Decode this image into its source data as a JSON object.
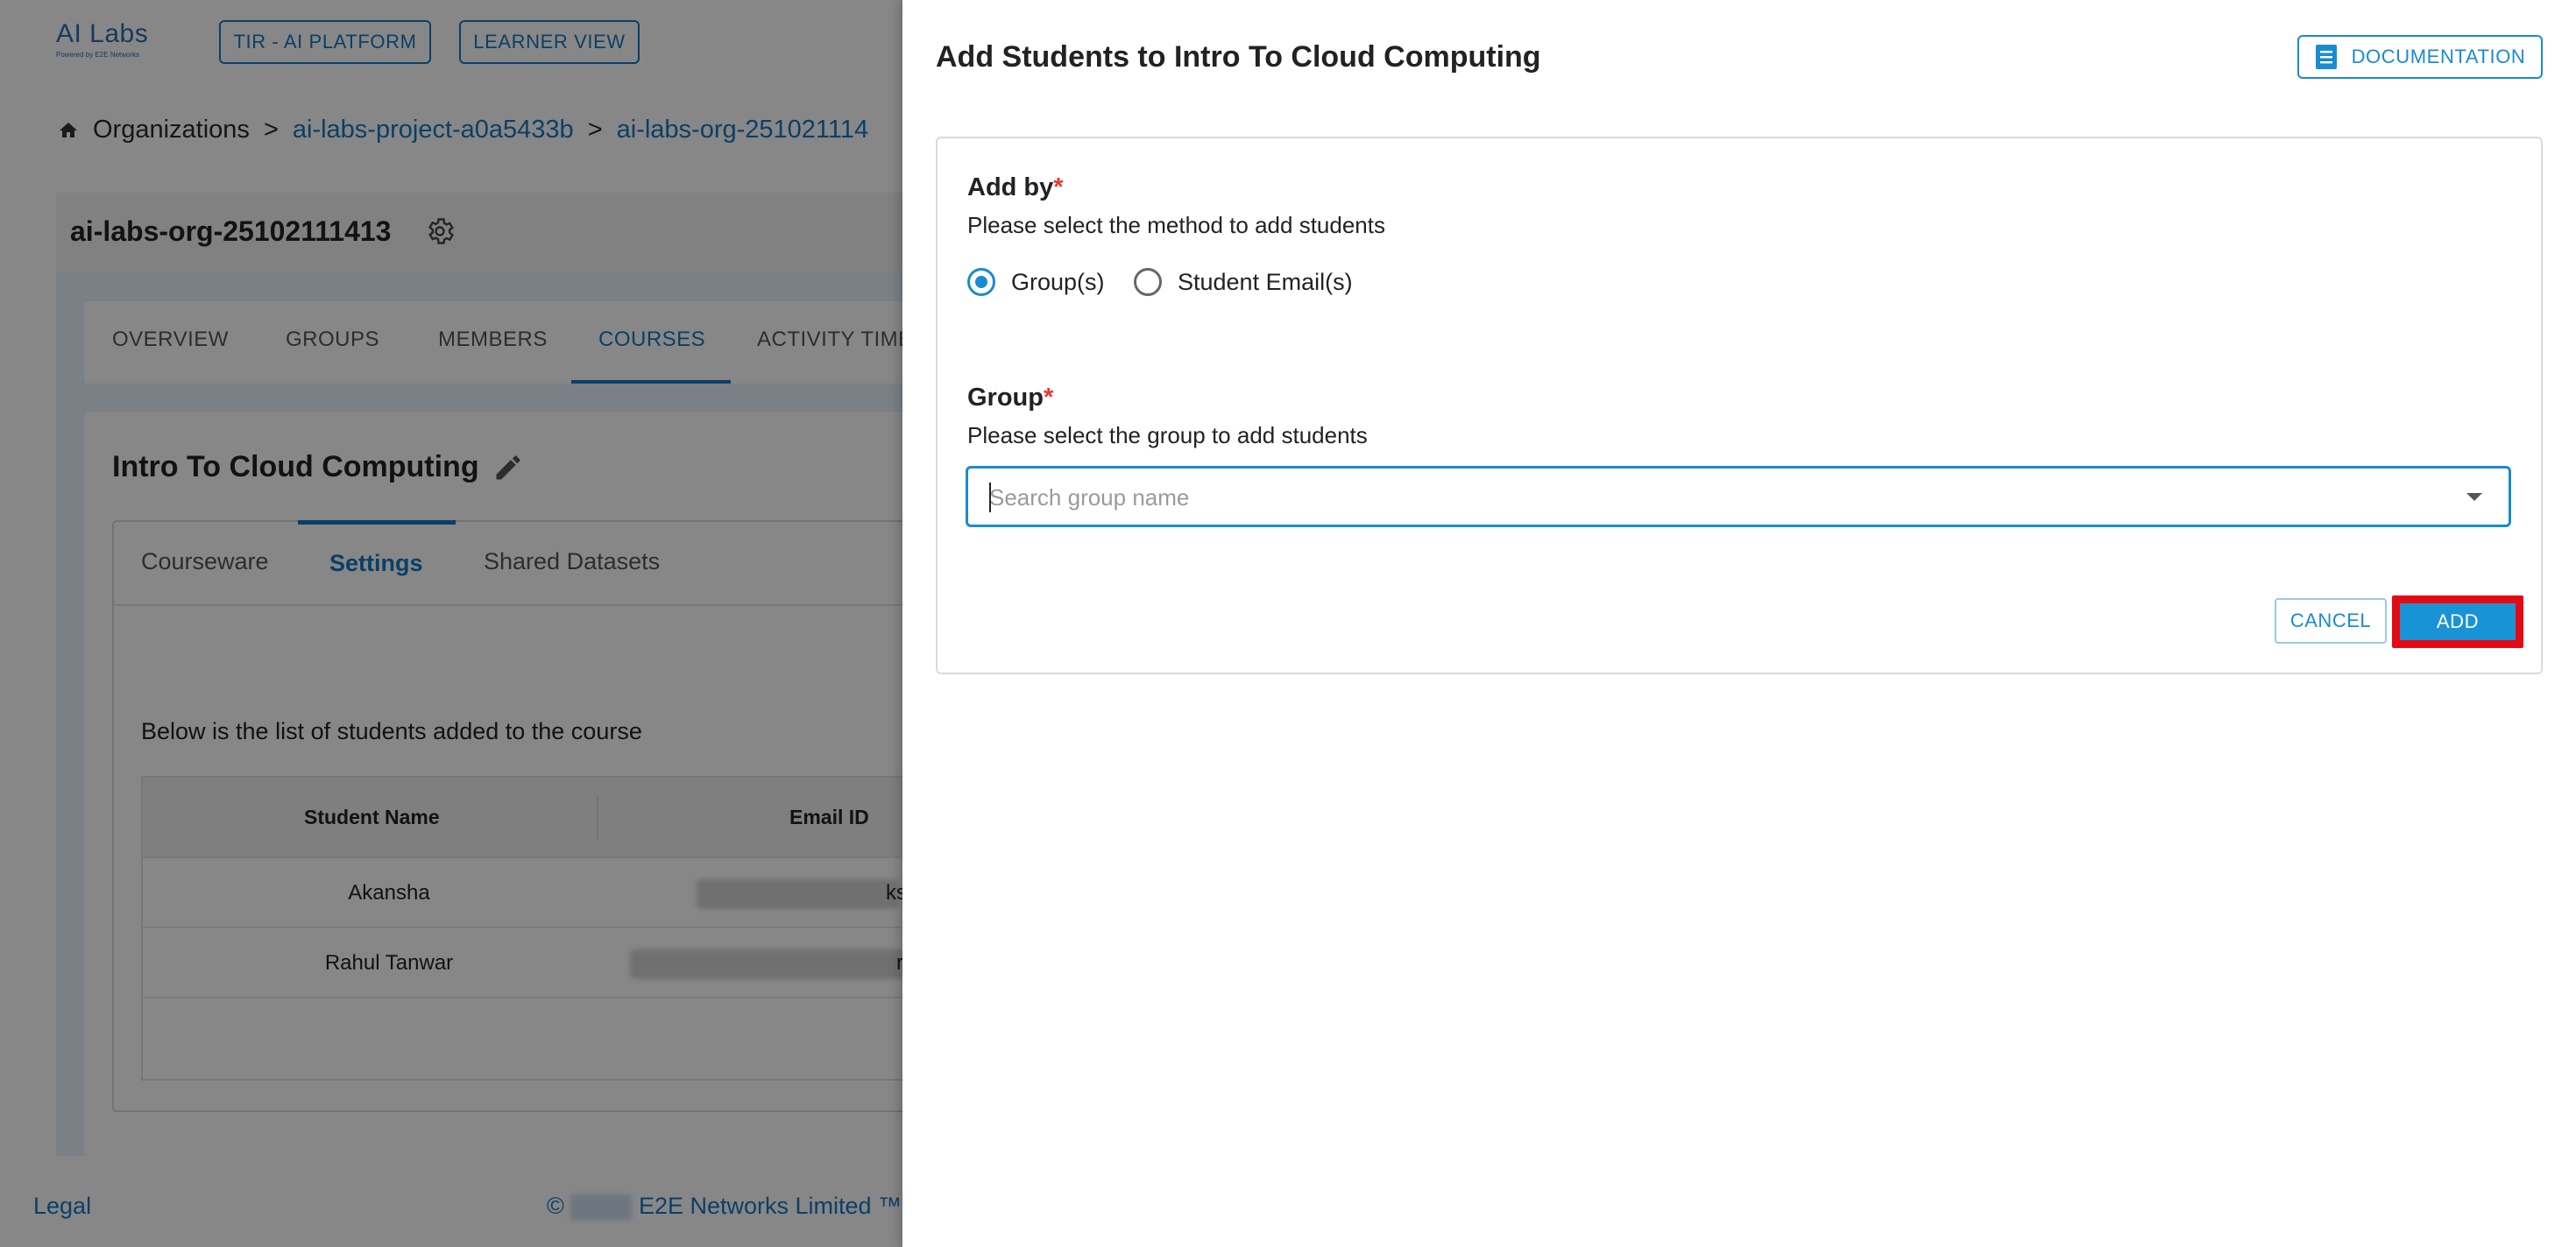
{
  "app": {
    "logo_text": "AI Labs",
    "logo_subtext": "Powered by E2E Networks",
    "top_buttons": [
      "TIR - AI PLATFORM",
      "LEARNER VIEW"
    ]
  },
  "breadcrumb": {
    "root": "Organizations",
    "separator": ">",
    "items": [
      "ai-labs-project-a0a5433b",
      "ai-labs-org-251021114"
    ]
  },
  "org": {
    "title": "ai-labs-org-25102111413",
    "tabs": [
      {
        "label": "OVERVIEW",
        "active": false
      },
      {
        "label": "GROUPS",
        "active": false
      },
      {
        "label": "MEMBERS",
        "active": false
      },
      {
        "label": "COURSES",
        "active": true
      },
      {
        "label": "ACTIVITY TIME",
        "active": false
      }
    ]
  },
  "course": {
    "title": "Intro To Cloud Computing",
    "subtabs": [
      {
        "label": "Courseware",
        "active": false
      },
      {
        "label": "Settings",
        "active": true
      },
      {
        "label": "Shared Datasets",
        "active": false
      }
    ],
    "list_caption": "Below is the list of students added to the course",
    "table": {
      "headers": [
        "Student Name",
        "Email ID"
      ],
      "rows": [
        {
          "name": "Akansha",
          "email_suffix": "ks"
        },
        {
          "name": "Rahul Tanwar",
          "email_suffix": "r"
        }
      ]
    }
  },
  "footer": {
    "legal": "Legal",
    "copyright_symbol": "©",
    "copyright": "E2E Networks Limited ™"
  },
  "drawer": {
    "title": "Add Students to Intro To Cloud Computing",
    "documentation_label": "DOCUMENTATION",
    "add_by": {
      "label": "Add by",
      "required_mark": "*",
      "help": "Please select the method to add students",
      "options": [
        {
          "label": "Group(s)",
          "checked": true
        },
        {
          "label": "Student Email(s)",
          "checked": false
        }
      ]
    },
    "group": {
      "label": "Group",
      "required_mark": "*",
      "help": "Please select the group to add students",
      "placeholder": "Search group name",
      "value": ""
    },
    "cancel_label": "CANCEL",
    "add_label": "ADD"
  },
  "colors": {
    "accent": "#1a8bd0",
    "required": "#e53935",
    "highlight": "#e50914"
  }
}
